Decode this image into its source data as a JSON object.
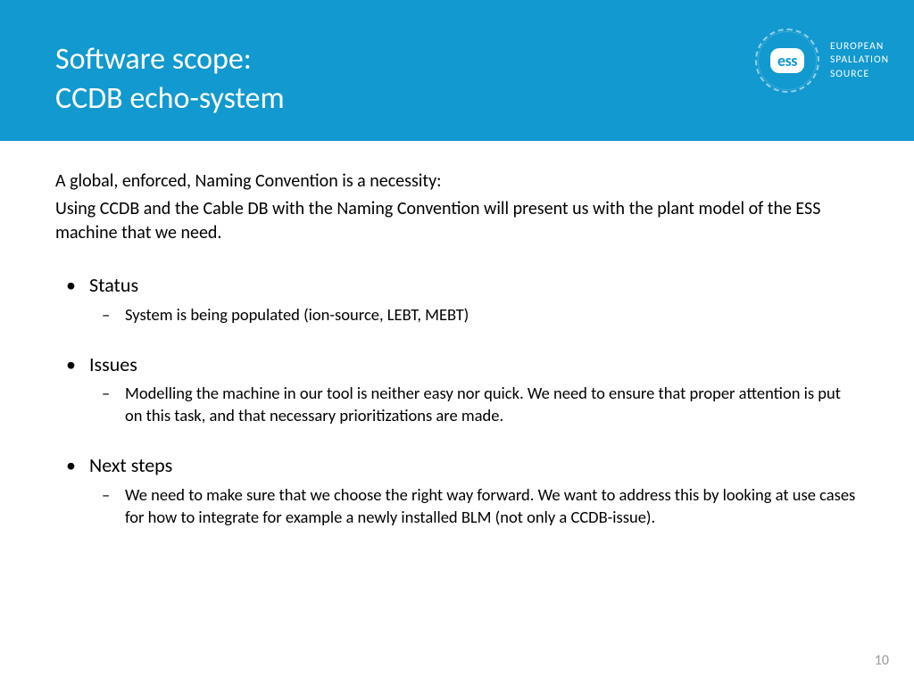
{
  "header": {
    "title_line1": "Software scope:",
    "title_line2": "CCDB echo-system"
  },
  "logo": {
    "mark": "ess",
    "text_line1": "EUROPEAN",
    "text_line2": "SPALLATION",
    "text_line3": "SOURCE"
  },
  "body": {
    "intro1": "A global, enforced, Naming Convention is a necessity:",
    "intro2": "Using CCDB and the Cable DB with the Naming Convention will present us with the plant model of the ESS machine that we need.",
    "sections": [
      {
        "heading": "Status",
        "items": [
          "System is being populated (ion-source, LEBT, MEBT)"
        ]
      },
      {
        "heading": "Issues",
        "items": [
          "Modelling the machine in our tool is neither easy nor quick. We need to ensure that proper attention is put on this task, and that necessary prioritizations are made."
        ]
      },
      {
        "heading": "Next steps",
        "items": [
          "We need to make sure that we choose the right way forward. We want to address this by looking at use cases for how to integrate for example a newly installed BLM (not only a CCDB-issue)."
        ]
      }
    ]
  },
  "page_number": "10"
}
